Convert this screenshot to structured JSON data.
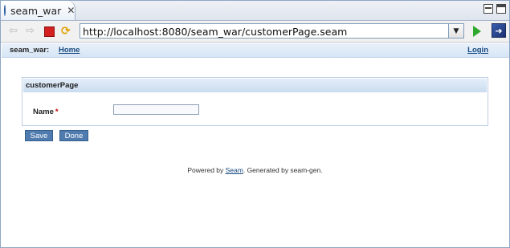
{
  "tab": {
    "title": "seam_war",
    "close_icon": "close-icon"
  },
  "window_controls": [
    "minimize-icon",
    "maximize-icon"
  ],
  "toolbar": {
    "back_icon": "back-arrow-icon",
    "forward_icon": "forward-arrow-icon",
    "stop_icon": "stop-icon",
    "refresh_icon": "refresh-icon",
    "url": "http://localhost:8080/seam_war/customerPage.seam",
    "go_icon": "go-icon"
  },
  "menubar": {
    "app_name": "seam_war:",
    "home": "Home",
    "login": "Login"
  },
  "form": {
    "header": "customerPage",
    "name_label": "Name",
    "required_mark": "*",
    "name_value": ""
  },
  "actions": {
    "save": "Save",
    "done": "Done"
  },
  "footer": {
    "prefix": "Powered by ",
    "link": "Seam",
    "suffix": ". Generated by seam-gen."
  },
  "colors": {
    "link": "#16497f",
    "button": "#4f7bae",
    "required": "#c00000"
  }
}
